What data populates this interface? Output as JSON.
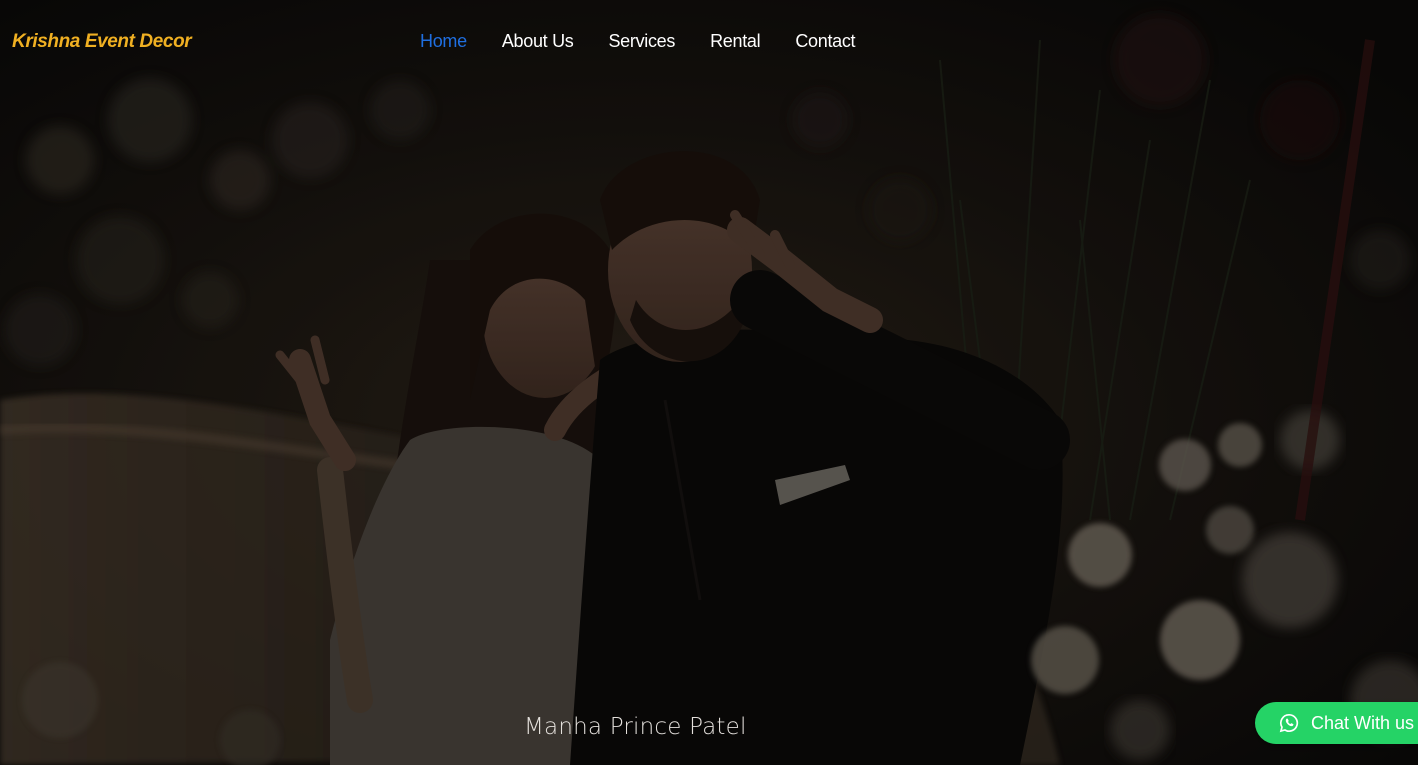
{
  "brand": {
    "name": "Krishna Event Decor",
    "color": "#f0b022"
  },
  "nav": {
    "items": [
      {
        "label": "Home",
        "active": true
      },
      {
        "label": "About Us",
        "active": false
      },
      {
        "label": "Services",
        "active": false
      },
      {
        "label": "Rental",
        "active": false
      },
      {
        "label": "Contact",
        "active": false
      }
    ],
    "active_color": "#1f6fe0"
  },
  "hero": {
    "image": "couple-photo",
    "caption": "Manha Prince Patel"
  },
  "chat": {
    "label": "Chat With us",
    "icon": "whatsapp-icon",
    "color": "#25d366"
  }
}
